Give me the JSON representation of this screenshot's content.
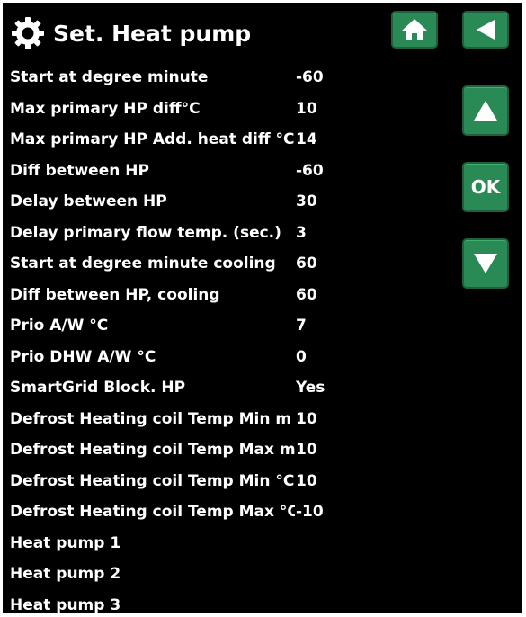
{
  "header": {
    "title": "Set. Heat pump"
  },
  "icons": {
    "settings": "gear-icon",
    "home": "home-icon",
    "back": "back-arrow-icon",
    "up": "up-arrow-icon",
    "down": "down-arrow-icon"
  },
  "nav": {
    "ok_label": "OK"
  },
  "colors": {
    "background": "#000000",
    "text": "#ffffff",
    "button": "#2a8a55"
  },
  "settings": [
    {
      "label": "Start at degree minute",
      "value": "-60"
    },
    {
      "label": "Max primary HP diff°C",
      "value": "10"
    },
    {
      "label": "Max primary HP Add. heat diff °C",
      "value": "14"
    },
    {
      "label": "Diff between HP",
      "value": "-60"
    },
    {
      "label": "Delay between HP",
      "value": "30"
    },
    {
      "label": "Delay primary flow temp. (sec.)",
      "value": "3"
    },
    {
      "label": "Start at degree minute cooling",
      "value": "60"
    },
    {
      "label": "Diff between HP, cooling",
      "value": "60"
    },
    {
      "label": "Prio A/W °C",
      "value": "7"
    },
    {
      "label": "Prio DHW A/W °C",
      "value": "0"
    },
    {
      "label": "SmartGrid Block. HP",
      "value": "Yes"
    },
    {
      "label": "Defrost Heating coil Temp Min m",
      "value": "10"
    },
    {
      "label": "Defrost Heating coil Temp Max m",
      "value": "10"
    },
    {
      "label": "Defrost Heating coil Temp Min °C",
      "value": "10"
    },
    {
      "label": "Defrost Heating coil Temp Max °C",
      "value": "-10"
    },
    {
      "label": "Heat pump 1",
      "value": ""
    },
    {
      "label": "Heat pump 2",
      "value": ""
    },
    {
      "label": "Heat pump 3",
      "value": ""
    }
  ]
}
